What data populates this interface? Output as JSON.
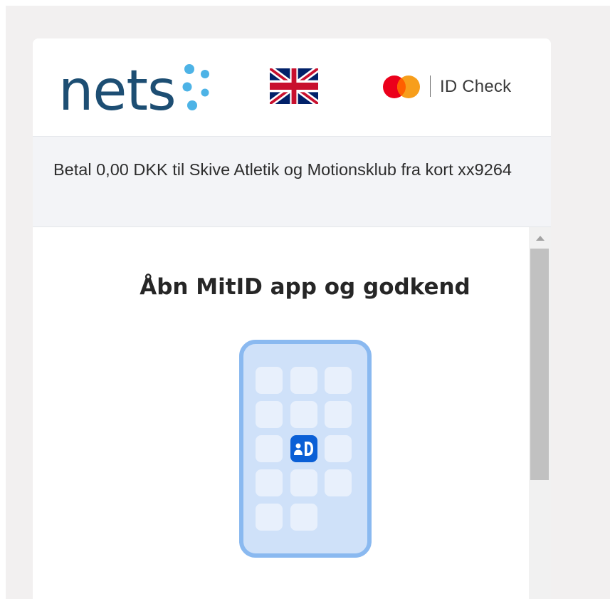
{
  "header": {
    "brand_logo": "nets",
    "language_flag": "uk-flag-icon",
    "card_scheme": "mastercard-logo",
    "id_check_label": "ID Check"
  },
  "payment": {
    "description": "Betal 0,00 DKK til Skive Atletik og Motionsklub fra kort xx9264"
  },
  "mitid": {
    "title": "Åbn MitID app og godkend",
    "illustration": "phone-with-mitid-app-icon",
    "app_icon_text": "ID"
  },
  "colors": {
    "nets_text": "#1d4e73",
    "nets_dots": "#4db3e6",
    "mc_red": "#eb001b",
    "mc_orange": "#f79e1b",
    "mitid_blue": "#0a5fd6",
    "phone_frame": "#8ab9f0",
    "phone_screen": "#cfe1f9",
    "phone_tiles": "#e8f0fc"
  }
}
